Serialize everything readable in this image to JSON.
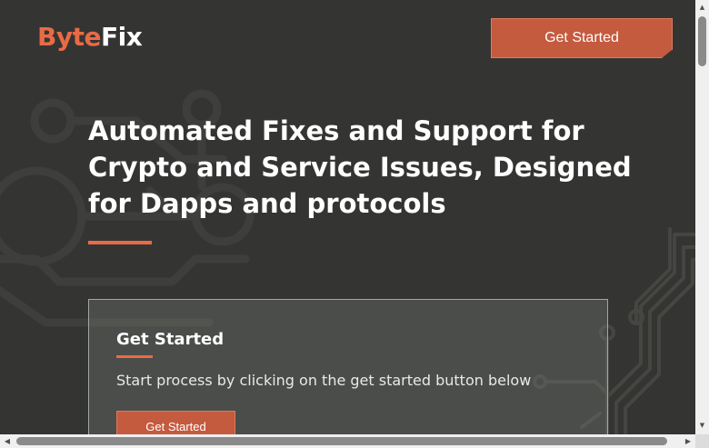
{
  "header": {
    "logo_part1": "Byte",
    "logo_part2": "Fix",
    "cta_label": "Get Started"
  },
  "hero": {
    "title": "Automated Fixes and Support for Crypto and Service Issues, Designed for Dapps and protocols"
  },
  "card": {
    "title": "Get Started",
    "description": "Start process by clicking on the get started button below",
    "button_label": "Get Started"
  },
  "icons": {
    "scroll_up": "▲",
    "scroll_down": "▼",
    "scroll_left": "◀",
    "scroll_right": "▶"
  },
  "colors": {
    "background": "#343533",
    "accent": "#ea6a46",
    "button": "#c45a3e",
    "text": "#ffffff"
  }
}
